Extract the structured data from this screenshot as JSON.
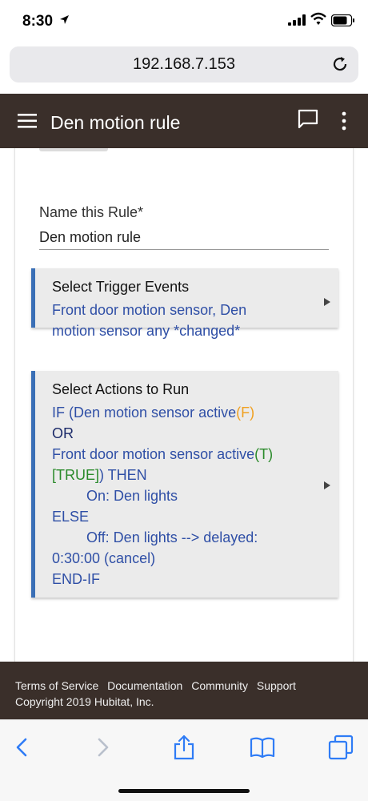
{
  "status_bar": {
    "time": "8:30",
    "icons": [
      "location-arrow-icon",
      "cellular-signal-icon",
      "wifi-icon",
      "battery-icon"
    ]
  },
  "browser": {
    "url": "192.168.7.153",
    "toolbar_icons": [
      "back-icon",
      "forward-icon",
      "share-icon",
      "bookmarks-icon",
      "tabs-icon"
    ]
  },
  "header": {
    "title": "Den motion rule",
    "icons": [
      "menu-icon",
      "feedback-icon",
      "more-vertical-icon"
    ],
    "background_color": "#3a2f2a"
  },
  "form": {
    "name_label": "Name this Rule*",
    "name_value": "Den motion rule"
  },
  "trigger_section": {
    "title": "Select Trigger Events",
    "lines": [
      "Front door motion sensor, Den",
      "motion sensor  any *changed*"
    ]
  },
  "actions_section": {
    "title": "Select Actions to Run",
    "line1_text": "IF (Den motion sensor  active",
    "line1_flag": "(F)",
    "line2": "OR",
    "line3_text": "Front door motion sensor active",
    "line3_flag": "(T)",
    "line4_flag": "[TRUE]",
    "line4_text": ") THEN",
    "line5": "On: Den lights",
    "line6": "ELSE",
    "line7": "Off: Den lights --> delayed:",
    "line8": "0:30:00 (cancel)",
    "line9": "END-IF"
  },
  "footer": {
    "links": [
      "Terms of Service",
      "Documentation",
      "Community",
      "Support"
    ],
    "copyright": "Copyright 2019 Hubitat, Inc."
  },
  "colors": {
    "accent": "#3a6fb6",
    "text_blue": "#2f4fa6",
    "false_orange": "#f0a020",
    "true_green": "#2a8a2a"
  }
}
